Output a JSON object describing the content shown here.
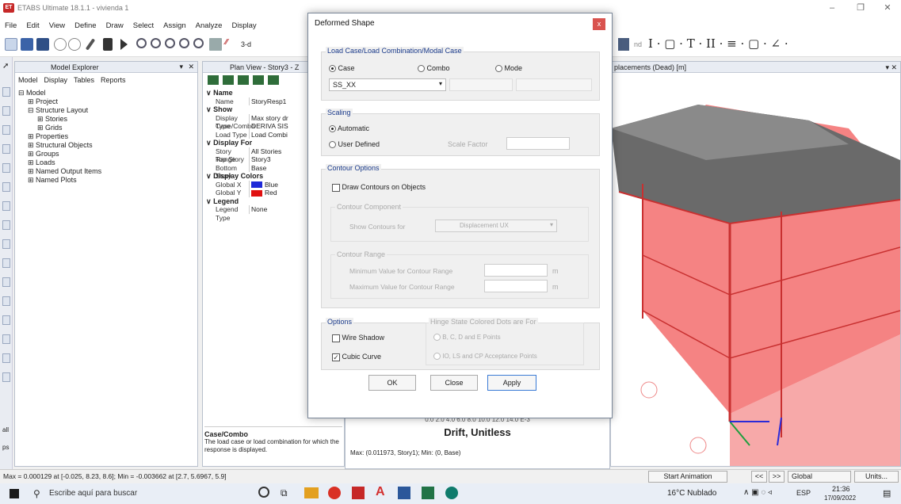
{
  "window": {
    "title": "ETABS Ultimate 18.1.1 - vivienda 1",
    "app_icon": "ET"
  },
  "menu": [
    "File",
    "Edit",
    "View",
    "Define",
    "Draw",
    "Select",
    "Assign",
    "Analyze",
    "Display"
  ],
  "toolbar": {
    "view_label": "3-d",
    "nd_label": "nd"
  },
  "explorer": {
    "title": "Model Explorer",
    "tabs": [
      "Model",
      "Display",
      "Tables",
      "Reports"
    ],
    "tree": [
      "Model",
      "Project",
      "Structure Layout",
      "Stories",
      "Grids",
      "Properties",
      "Structural Objects",
      "Groups",
      "Loads",
      "Named Output Items",
      "Named Plots"
    ]
  },
  "plan": {
    "title": "Plan View - Story3 - Z",
    "sections": {
      "name_head": "Name",
      "show_head": "Show",
      "display_for_head": "Display For",
      "display_colors_head": "Display Colors",
      "legend_head": "Legend"
    },
    "rows": {
      "name_k": "Name",
      "name_v": "StoryResp1",
      "display_type_k": "Display Type",
      "display_type_v": "Max story dr",
      "case_combo_k": "Case/Combo",
      "case_combo_v": "DERIVA SIS",
      "load_type_k": "Load Type",
      "load_type_v": "Load Combi",
      "story_range_k": "Story Range",
      "story_range_v": "All Stories",
      "top_story_k": "Top Story",
      "top_story_v": "Story3",
      "bottom_story_k": "Bottom Story",
      "bottom_story_v": "Base",
      "global_x_k": "Global X",
      "global_x_v": "Blue",
      "global_y_k": "Global Y",
      "global_y_v": "Red",
      "legend_type_k": "Legend Type",
      "legend_type_v": "None"
    },
    "help_title": "Case/Combo",
    "help_text": "The load case or load combination for which the response is displayed."
  },
  "view3d": {
    "title": "placements (Dead) [m]"
  },
  "drift": {
    "scale": "0.0  2.0  4.0  6.0  8.0  10.0 12.0 14.0 E-3",
    "title": "Drift, Unitless",
    "max_text": "Max: (0.011973, Story1);  Min: (0, Base)"
  },
  "status": {
    "text": "Max = 0.000129 at [-0.025, 8.23, 8.6];  Min = -0.003662 at [2.7, 5.6967, 5.9]",
    "start_animation": "Start Animation",
    "prev": "<<",
    "next": ">>",
    "coord": "Global",
    "units": "Units..."
  },
  "dialog": {
    "title": "Deformed Shape",
    "close": "x",
    "load_group": "Load Case/Load Combination/Modal Case",
    "radio_case": "Case",
    "radio_combo": "Combo",
    "radio_mode": "Mode",
    "case_value": "SS_XX",
    "scaling_group": "Scaling",
    "automatic": "Automatic",
    "user_defined": "User Defined",
    "scale_factor": "Scale Factor",
    "contour_group": "Contour Options",
    "draw_contours": "Draw Contours on Objects",
    "contour_component": "Contour Component",
    "show_contours_for": "Show Contours for",
    "contour_value": "Displacement UX",
    "contour_range": "Contour Range",
    "min_value": "Minimum Value for Contour Range",
    "max_value": "Maximum Value for Contour Range",
    "unit": "m",
    "options_group": "Options",
    "wire_shadow": "Wire Shadow",
    "cubic_curve": "Cubic Curve",
    "hinge_group": "Hinge State Colored Dots are For",
    "hinge_opt1": "B, C, D and E Points",
    "hinge_opt2": "IO, LS and CP Acceptance Points",
    "ok": "OK",
    "close_btn": "Close",
    "apply": "Apply"
  },
  "taskbar": {
    "search": "Escribe aquí para buscar",
    "weather": "16°C  Nublado",
    "lang": "ESP",
    "time": "21:36",
    "date": "17/09/2022"
  },
  "colors": {
    "accent": "#1a3a8a",
    "building_red": "#f05a5a",
    "close_red": "#d9534f"
  }
}
